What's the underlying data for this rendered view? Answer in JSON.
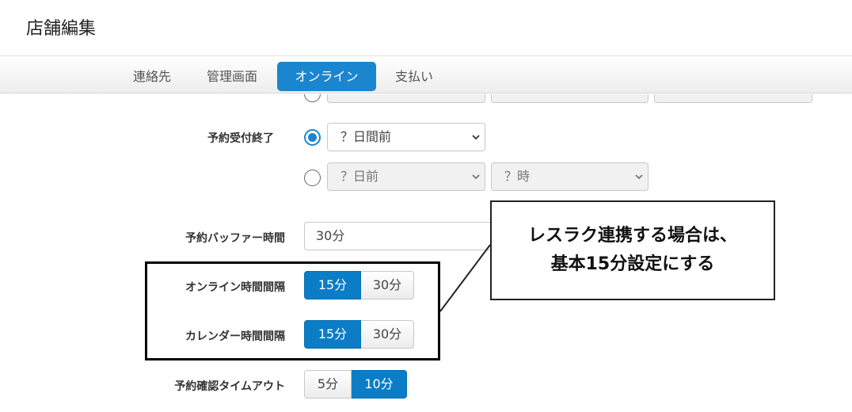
{
  "page": {
    "title": "店舗編集"
  },
  "tabs": [
    {
      "label": "連絡先",
      "active": false
    },
    {
      "label": "管理画面",
      "active": false
    },
    {
      "label": "オンライン",
      "active": true
    },
    {
      "label": "支払い",
      "active": false
    }
  ],
  "reservation_end": {
    "label": "予約受付終了",
    "option1": {
      "selected": true,
      "value": "？日間前"
    },
    "option2": {
      "selected": false,
      "day_value": "？日前",
      "time_value": "？時"
    }
  },
  "buffer": {
    "label": "予約バッファー時間",
    "value": "30分"
  },
  "online_interval": {
    "label": "オンライン時間間隔",
    "options": [
      "15分",
      "30分"
    ],
    "selected": "15分"
  },
  "calendar_interval": {
    "label": "カレンダー時間間隔",
    "options": [
      "15分",
      "30分"
    ],
    "selected": "15分"
  },
  "confirm_timeout": {
    "label": "予約確認タイムアウト",
    "options": [
      "5分",
      "10分"
    ],
    "selected": "10分"
  },
  "callout": {
    "line1": "レスラク連携する場合は、",
    "line2": "基本15分設定にする"
  },
  "colors": {
    "accent": "#1a86d0",
    "selected_segment": "#0a7dc6"
  }
}
